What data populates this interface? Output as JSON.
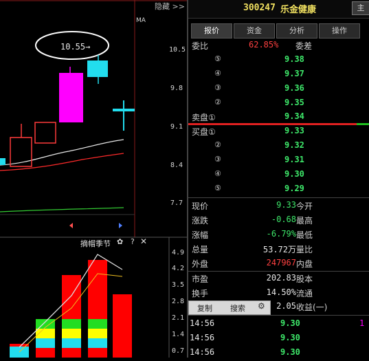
{
  "header": {
    "code": "300247",
    "name": "乐金健康",
    "toggle_label": "隐藏 >>",
    "right_btn": "主"
  },
  "tabs": [
    {
      "label": "报价",
      "active": true
    },
    {
      "label": "资金",
      "active": false
    },
    {
      "label": "分析",
      "active": false
    },
    {
      "label": "操作",
      "active": false
    }
  ],
  "main_chart": {
    "ma_label": "MA",
    "callout": "10.55→",
    "y_ticks": [
      "10.5",
      "9.8",
      "9.1",
      "8.4",
      "7.7"
    ],
    "colors": {
      "up": "#ff2a2a",
      "bull_fill": "#ff00ff",
      "cyan": "#22ddee",
      "ma1": "#e8e8e8",
      "ma2": "#ff2a2a",
      "ma3": "#33cc33"
    }
  },
  "sub_chart": {
    "title": "摘帽季节",
    "icons": [
      "gear-icon",
      "help-icon",
      "close-icon"
    ],
    "y_ticks": [
      "4.9",
      "4.2",
      "3.5",
      "2.8",
      "2.1",
      "1.4",
      "0.7"
    ],
    "colors": {
      "bar": "#ff0000",
      "band1": "#22ddee",
      "band2": "#ffff00",
      "band3": "#22dd22"
    }
  },
  "quote": {
    "wei_bi_label": "委比",
    "wei_bi_value": "62.85%",
    "wei_cha_label": "委差",
    "sell": [
      {
        "idx": "⑤",
        "price": "9.38"
      },
      {
        "idx": "④",
        "price": "9.37"
      },
      {
        "idx": "③",
        "price": "9.36"
      },
      {
        "idx": "②",
        "price": "9.35"
      },
      {
        "idx": "卖盘①",
        "price": "9.34"
      }
    ],
    "buy": [
      {
        "idx": "买盘①",
        "price": "9.33"
      },
      {
        "idx": "②",
        "price": "9.32"
      },
      {
        "idx": "③",
        "price": "9.31"
      },
      {
        "idx": "④",
        "price": "9.30"
      },
      {
        "idx": "⑤",
        "price": "9.29"
      }
    ],
    "stats": [
      {
        "label": "现价",
        "value": "9.33",
        "right": "今开",
        "color": "green"
      },
      {
        "label": "涨跌",
        "value": "-0.68",
        "right": "最高",
        "color": "green"
      },
      {
        "label": "涨幅",
        "value": "-6.79%",
        "right": "最低",
        "color": "green"
      },
      {
        "label": "总量",
        "value": "53.72万",
        "right": "量比",
        "color": "white"
      },
      {
        "label": "外盘",
        "value": "247967",
        "right": "内盘",
        "color": "red"
      },
      {
        "label": "市盈",
        "value": "202.83",
        "right": "股本",
        "color": "white"
      },
      {
        "label": "换手",
        "value": "14.50%",
        "right": "流通",
        "color": "white"
      }
    ],
    "context_menu": {
      "copy": "复制",
      "search": "搜索",
      "value": "2.05",
      "right": "收益(一)"
    },
    "trades": [
      {
        "time": "14:56",
        "price": "9.30"
      },
      {
        "time": "14:56",
        "price": "9.30"
      },
      {
        "time": "14:56",
        "price": "9.30"
      }
    ]
  }
}
